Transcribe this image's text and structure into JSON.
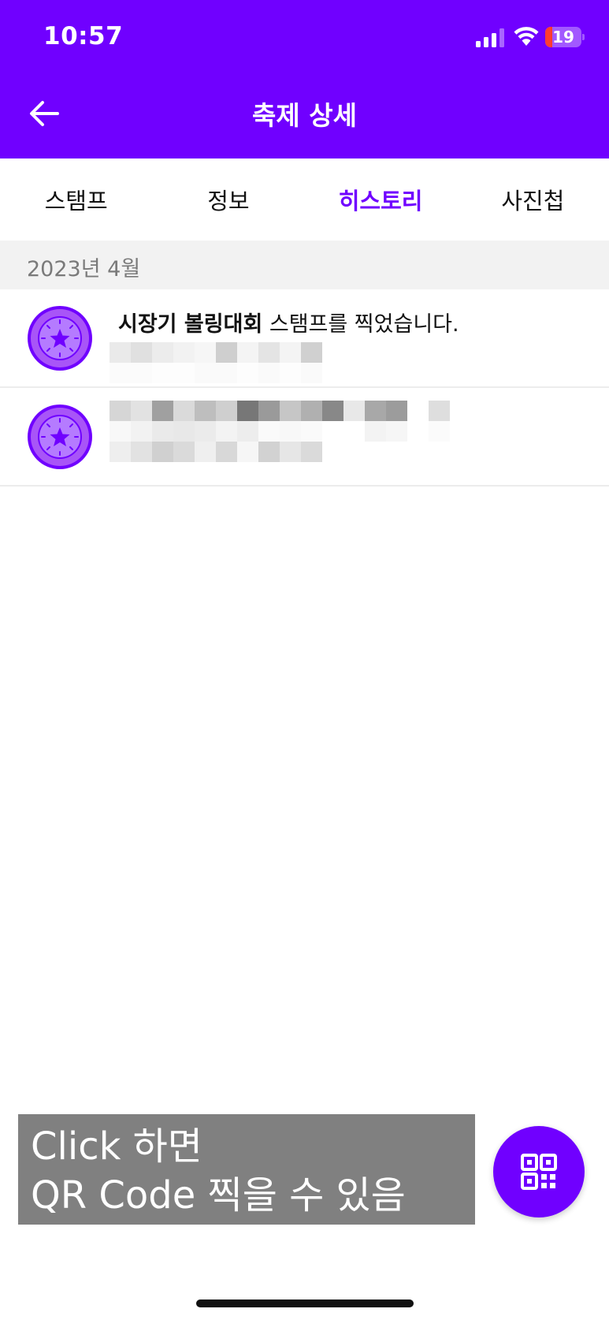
{
  "status_bar": {
    "time": "10:57",
    "battery_level": "19"
  },
  "nav": {
    "title": "축제 상세",
    "back_icon": "arrow-left-icon"
  },
  "tabs": [
    {
      "label": "스탬프",
      "active": false
    },
    {
      "label": "정보",
      "active": false
    },
    {
      "label": "히스토리",
      "active": true
    },
    {
      "label": "사진첩",
      "active": false
    }
  ],
  "history": {
    "section_label": "2023년 4월",
    "items": [
      {
        "bold_text": "시장기 볼링대회",
        "text": " 스탬프를 찍었습니다.",
        "icon": "stamp-badge-icon"
      },
      {
        "bold_text": "",
        "text": "",
        "icon": "stamp-badge-icon"
      }
    ]
  },
  "caption": {
    "line1": "Click 하면",
    "line2": "QR Code 찍을 수 있음"
  },
  "colors": {
    "brand": "#7000FF",
    "stamp_outer": "#A855F7",
    "stamp_inner": "#B57BFF",
    "battery_low": "#FF3B30"
  }
}
